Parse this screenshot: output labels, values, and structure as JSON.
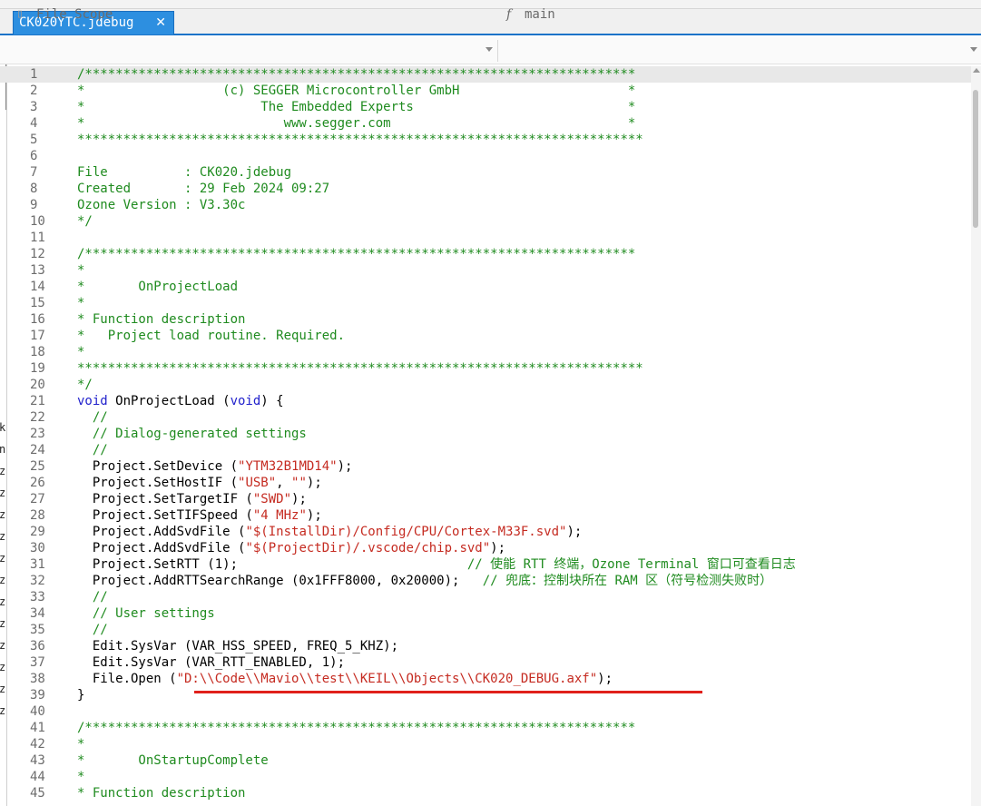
{
  "tab": {
    "title": "CK020YTC.jdebug",
    "close": "✕"
  },
  "scope": {
    "file_scope_label": "File Scope",
    "function_label": "main",
    "function_icon": "f"
  },
  "left_panel_chars": [
    "k",
    "n",
    "z",
    "z",
    "z",
    "z",
    "z",
    "z",
    "z",
    "z",
    "z",
    "z",
    "z",
    "z"
  ],
  "lines": [
    {
      "n": "1",
      "current": true,
      "tokens": [
        [
          "cm",
          "/************************************************************************"
        ]
      ]
    },
    {
      "n": "2",
      "tokens": [
        [
          "cm",
          "*                  (c) SEGGER Microcontroller GmbH                      *"
        ]
      ]
    },
    {
      "n": "3",
      "tokens": [
        [
          "cm",
          "*                       The Embedded Experts                            *"
        ]
      ]
    },
    {
      "n": "4",
      "tokens": [
        [
          "cm",
          "*                          www.segger.com                               *"
        ]
      ]
    },
    {
      "n": "5",
      "tokens": [
        [
          "cm",
          "**************************************************************************"
        ]
      ]
    },
    {
      "n": "6",
      "tokens": []
    },
    {
      "n": "7",
      "tokens": [
        [
          "cm",
          "File          : CK020.jdebug"
        ]
      ]
    },
    {
      "n": "8",
      "tokens": [
        [
          "cm",
          "Created       : 29 Feb 2024 09:27"
        ]
      ]
    },
    {
      "n": "9",
      "tokens": [
        [
          "cm",
          "Ozone Version : V3.30c"
        ]
      ]
    },
    {
      "n": "10",
      "tokens": [
        [
          "cm",
          "*/"
        ]
      ]
    },
    {
      "n": "11",
      "tokens": []
    },
    {
      "n": "12",
      "tokens": [
        [
          "cm",
          "/************************************************************************"
        ]
      ]
    },
    {
      "n": "13",
      "tokens": [
        [
          "cm",
          "*"
        ]
      ]
    },
    {
      "n": "14",
      "tokens": [
        [
          "cm",
          "*       OnProjectLoad"
        ]
      ]
    },
    {
      "n": "15",
      "tokens": [
        [
          "cm",
          "*"
        ]
      ]
    },
    {
      "n": "16",
      "tokens": [
        [
          "cm",
          "* Function description"
        ]
      ]
    },
    {
      "n": "17",
      "tokens": [
        [
          "cm",
          "*   Project load routine. Required."
        ]
      ]
    },
    {
      "n": "18",
      "tokens": [
        [
          "cm",
          "*"
        ]
      ]
    },
    {
      "n": "19",
      "tokens": [
        [
          "cm",
          "**************************************************************************"
        ]
      ]
    },
    {
      "n": "20",
      "tokens": [
        [
          "cm",
          "*/"
        ]
      ]
    },
    {
      "n": "21",
      "tokens": [
        [
          "kw",
          "void"
        ],
        [
          "pl",
          " OnProjectLoad ("
        ],
        [
          "kw",
          "void"
        ],
        [
          "pl",
          ") {"
        ]
      ]
    },
    {
      "n": "22",
      "tokens": [
        [
          "pl",
          "  "
        ],
        [
          "cm",
          "//"
        ]
      ]
    },
    {
      "n": "23",
      "tokens": [
        [
          "pl",
          "  "
        ],
        [
          "cm",
          "// Dialog-generated settings"
        ]
      ]
    },
    {
      "n": "24",
      "tokens": [
        [
          "pl",
          "  "
        ],
        [
          "cm",
          "//"
        ]
      ]
    },
    {
      "n": "25",
      "tokens": [
        [
          "pl",
          "  Project.SetDevice ("
        ],
        [
          "st",
          "\"YTM32B1MD14\""
        ],
        [
          "pl",
          ");"
        ]
      ]
    },
    {
      "n": "26",
      "tokens": [
        [
          "pl",
          "  Project.SetHostIF ("
        ],
        [
          "st",
          "\"USB\""
        ],
        [
          "pl",
          ", "
        ],
        [
          "st",
          "\"\""
        ],
        [
          "pl",
          ");"
        ]
      ]
    },
    {
      "n": "27",
      "tokens": [
        [
          "pl",
          "  Project.SetTargetIF ("
        ],
        [
          "st",
          "\"SWD\""
        ],
        [
          "pl",
          ");"
        ]
      ]
    },
    {
      "n": "28",
      "tokens": [
        [
          "pl",
          "  Project.SetTIFSpeed ("
        ],
        [
          "st",
          "\"4 MHz\""
        ],
        [
          "pl",
          ");"
        ]
      ]
    },
    {
      "n": "29",
      "tokens": [
        [
          "pl",
          "  Project.AddSvdFile ("
        ],
        [
          "st",
          "\"$(InstallDir)/Config/CPU/Cortex-M33F.svd\""
        ],
        [
          "pl",
          ");"
        ]
      ]
    },
    {
      "n": "30",
      "tokens": [
        [
          "pl",
          "  Project.AddSvdFile ("
        ],
        [
          "st",
          "\"$(ProjectDir)/.vscode/chip.svd\""
        ],
        [
          "pl",
          ");"
        ]
      ]
    },
    {
      "n": "31",
      "tokens": [
        [
          "pl",
          "  Project.SetRTT (1);                              "
        ],
        [
          "cm",
          "// 使能 RTT 终端，Ozone Terminal 窗口可查看日志"
        ]
      ]
    },
    {
      "n": "32",
      "tokens": [
        [
          "pl",
          "  Project.AddRTTSearchRange (0x1FFF8000, 0x20000);   "
        ],
        [
          "cm",
          "// 兜底：控制块所在 RAM 区（符号检测失败时）"
        ]
      ]
    },
    {
      "n": "33",
      "tokens": [
        [
          "pl",
          "  "
        ],
        [
          "cm",
          "//"
        ]
      ]
    },
    {
      "n": "34",
      "tokens": [
        [
          "pl",
          "  "
        ],
        [
          "cm",
          "// User settings"
        ]
      ]
    },
    {
      "n": "35",
      "tokens": [
        [
          "pl",
          "  "
        ],
        [
          "cm",
          "//"
        ]
      ]
    },
    {
      "n": "36",
      "tokens": [
        [
          "pl",
          "  Edit.SysVar (VAR_HSS_SPEED, FREQ_5_KHZ);"
        ]
      ]
    },
    {
      "n": "37",
      "tokens": [
        [
          "pl",
          "  Edit.SysVar (VAR_RTT_ENABLED, 1);"
        ]
      ]
    },
    {
      "n": "38",
      "tokens": [
        [
          "pl",
          "  File.Open ("
        ],
        [
          "st",
          "\"D:\\\\Code\\\\Mavio\\\\test\\\\KEIL\\\\Objects\\\\CK020_DEBUG.axf\""
        ],
        [
          "pl",
          ");"
        ]
      ]
    },
    {
      "n": "39",
      "tokens": [
        [
          "pl",
          "}"
        ]
      ]
    },
    {
      "n": "40",
      "tokens": []
    },
    {
      "n": "41",
      "tokens": [
        [
          "cm",
          "/************************************************************************"
        ]
      ]
    },
    {
      "n": "42",
      "tokens": [
        [
          "cm",
          "*"
        ]
      ]
    },
    {
      "n": "43",
      "tokens": [
        [
          "cm",
          "*       OnStartupComplete"
        ]
      ]
    },
    {
      "n": "44",
      "tokens": [
        [
          "cm",
          "*"
        ]
      ]
    },
    {
      "n": "45",
      "tokens": [
        [
          "cm",
          "* Function description"
        ]
      ]
    }
  ],
  "colors": {
    "comment": "#1f8b1f",
    "keyword": "#2222cc",
    "string": "#c52b21",
    "tab_bg": "#2d8fe0",
    "highlight_underline": "#e0201b"
  }
}
